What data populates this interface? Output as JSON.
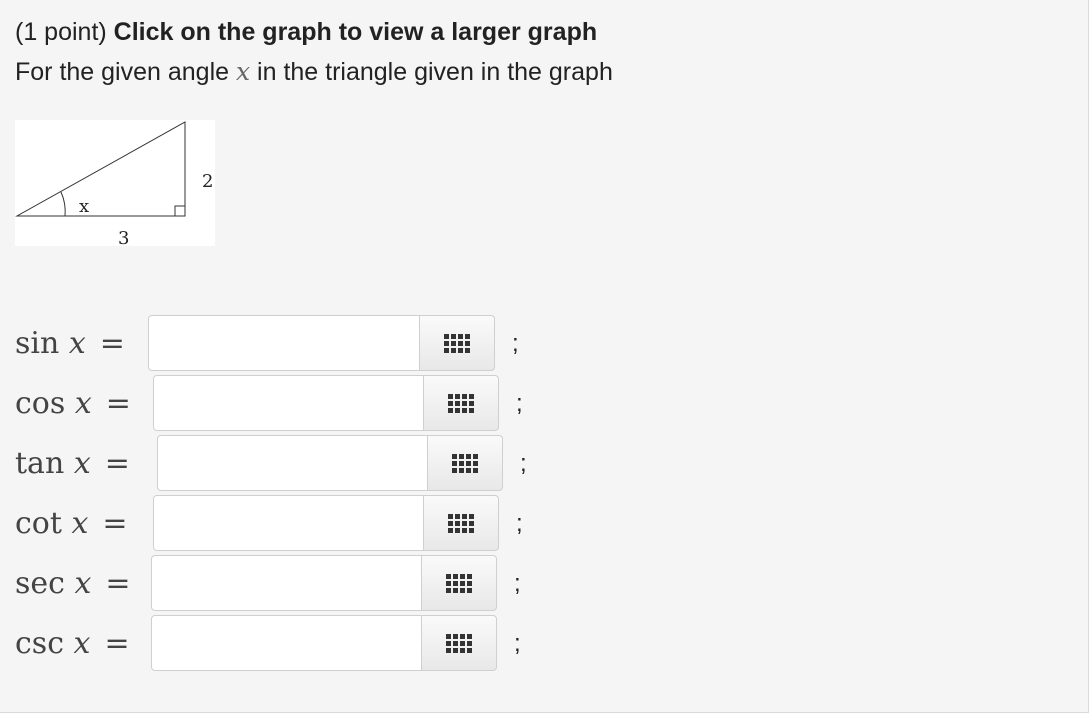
{
  "problem": {
    "points": "(1 point)",
    "instruction": "Click on the graph to view a larger graph",
    "prompt_before": "For the given angle",
    "variable": "x",
    "prompt_after": "in the triangle given in the graph"
  },
  "graph": {
    "angle_label": "x",
    "opposite_label": "2",
    "adjacent_label": "3"
  },
  "answers": [
    {
      "fn": "sin",
      "var": "x",
      "eq": "=",
      "value": "",
      "sep": ";"
    },
    {
      "fn": "cos",
      "var": "x",
      "eq": "=",
      "value": "",
      "sep": ";"
    },
    {
      "fn": "tan",
      "var": "x",
      "eq": "=",
      "value": "",
      "sep": ";"
    },
    {
      "fn": "cot",
      "var": "x",
      "eq": "=",
      "value": "",
      "sep": ";"
    },
    {
      "fn": "sec",
      "var": "x",
      "eq": "=",
      "value": "",
      "sep": ";"
    },
    {
      "fn": "csc",
      "var": "x",
      "eq": "=",
      "value": "",
      "sep": ";"
    }
  ]
}
